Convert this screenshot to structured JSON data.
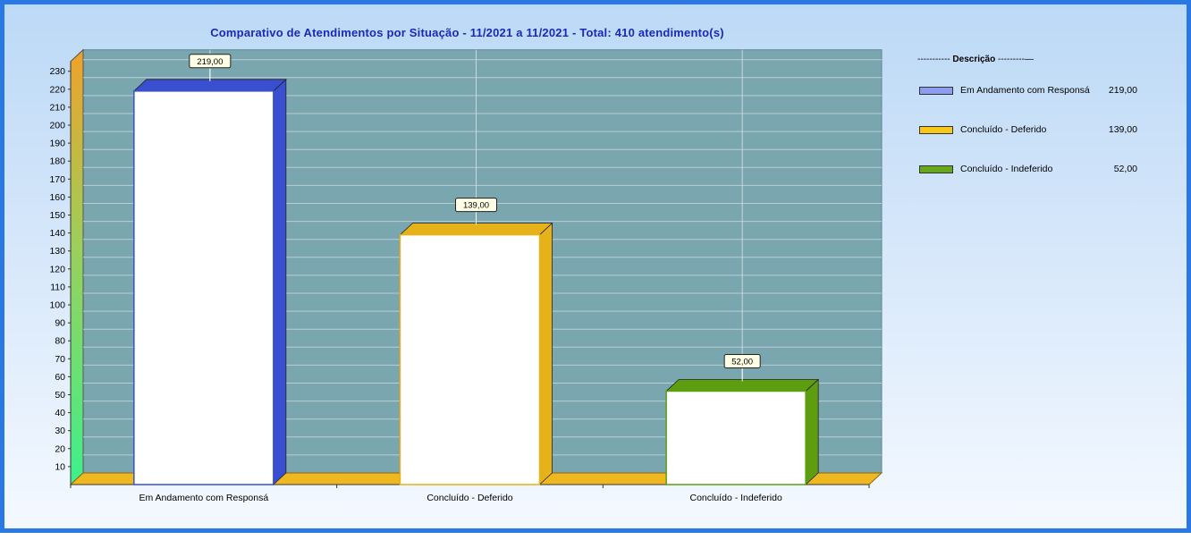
{
  "colors": {
    "frame": "#2a78e4",
    "title": "#1a2ab8",
    "plot_bg": "#7aa6b0",
    "grid": "#b9cfd3",
    "floor": "#f0b820",
    "bar_face": "#ffffff"
  },
  "legend": {
    "title_left": "----------- ",
    "title_bold": "Descrição",
    "title_right": " ---------—"
  },
  "chart_data": {
    "type": "bar",
    "title": "Comparativo  de  Atendimentos  por  Situação  -  11/2021  a  11/2021  -  Total:  410  atendimento(s)",
    "categories": [
      "Em Andamento com Responsá",
      "Concluído - Deferido",
      "Concluído - Indeferido"
    ],
    "values": [
      219,
      139,
      52
    ],
    "value_labels": [
      "219,00",
      "139,00",
      "52,00"
    ],
    "series_colors": [
      "#3a4fd0",
      "#e6b21a",
      "#5c9e10"
    ],
    "legend_colors": [
      "#8c9cf0",
      "#f7c81a",
      "#66a81a"
    ],
    "ylim": [
      0,
      230
    ],
    "yticks": [
      10,
      20,
      30,
      40,
      50,
      60,
      70,
      80,
      90,
      100,
      110,
      120,
      130,
      140,
      150,
      160,
      170,
      180,
      190,
      200,
      210,
      220,
      230
    ],
    "grid": true,
    "legend_position": "right",
    "xlabel": "",
    "ylabel": ""
  }
}
